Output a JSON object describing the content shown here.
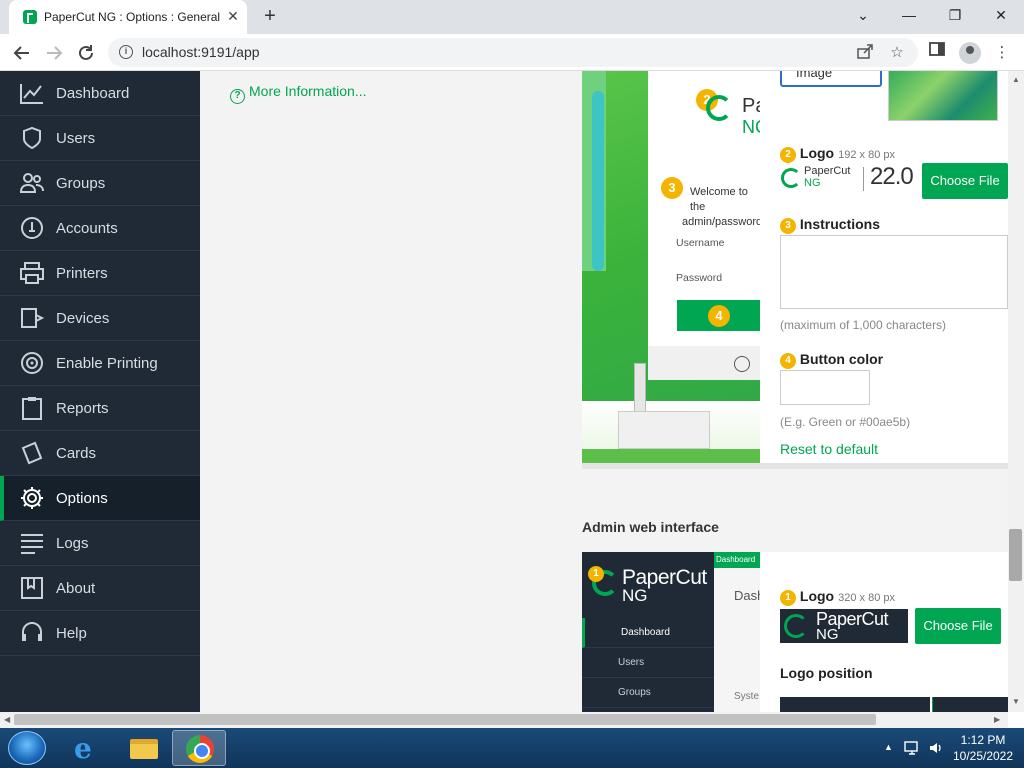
{
  "browser": {
    "tab_title": "PaperCut NG : Options : General",
    "tab_close": "✕",
    "new_tab": "+",
    "url": "localhost:9191/app",
    "window_controls": {
      "minimize": "—",
      "restore": "❐",
      "close": "✕",
      "tab_list": "⌄"
    }
  },
  "sidebar": {
    "items": [
      {
        "label": "Dashboard",
        "icon": "chart-line-icon"
      },
      {
        "label": "Users",
        "icon": "user-icon"
      },
      {
        "label": "Groups",
        "icon": "group-icon"
      },
      {
        "label": "Accounts",
        "icon": "piggy-bank-icon"
      },
      {
        "label": "Printers",
        "icon": "printer-icon"
      },
      {
        "label": "Devices",
        "icon": "device-icon"
      },
      {
        "label": "Enable Printing",
        "icon": "enable-printing-icon"
      },
      {
        "label": "Reports",
        "icon": "clipboard-icon"
      },
      {
        "label": "Cards",
        "icon": "card-icon"
      },
      {
        "label": "Options",
        "icon": "gear-icon",
        "active": true
      },
      {
        "label": "Logs",
        "icon": "lines-icon"
      },
      {
        "label": "About",
        "icon": "book-icon"
      },
      {
        "label": "Help",
        "icon": "headset-icon"
      }
    ]
  },
  "main": {
    "more_info": "More Information...",
    "user_web": {
      "type_select_value": "Image",
      "preview": {
        "welcome_line1": "Welcome to the",
        "welcome_line2": "admin/password.",
        "username_label": "Username",
        "password_label": "Password",
        "badge2": "2",
        "badge3": "3",
        "badge4": "4",
        "logo_fragment_top": "Pa",
        "logo_fragment_ng": "NG"
      },
      "logo_label": "Logo",
      "logo_badge": "2",
      "logo_size": "192 x 80 px",
      "logo_brand": "PaperCut",
      "logo_ng": "NG",
      "logo_version": "22.0",
      "choose_file": "Choose File",
      "instructions_label": "Instructions",
      "instructions_badge": "3",
      "instructions_hint": "(maximum of 1,000 characters)",
      "button_color_label": "Button color",
      "button_color_badge": "4",
      "button_color_hint": "(E.g. Green or #00ae5b)",
      "reset_link": "Reset to default"
    },
    "admin_web": {
      "title": "Admin web interface",
      "preview": {
        "badge1": "1",
        "logo_brand": "PaperCut",
        "logo_ng": "NG",
        "topbar_text": "Dashboard",
        "content_title": "Dash",
        "nav": [
          "Dashboard",
          "Users",
          "Groups"
        ],
        "system_text": "Syste"
      },
      "logo_label": "Logo",
      "logo_badge": "1",
      "logo_size": "320 x 80 px",
      "logo_brand": "PaperCut",
      "logo_ng": "NG",
      "choose_file": "Choose File",
      "logo_position_label": "Logo position"
    }
  },
  "taskbar": {
    "time": "1:12 PM",
    "date": "10/25/2022"
  },
  "colors": {
    "brand_green": "#00a651",
    "sidebar_bg": "#1f2a36",
    "badge_yellow": "#f4b400"
  }
}
